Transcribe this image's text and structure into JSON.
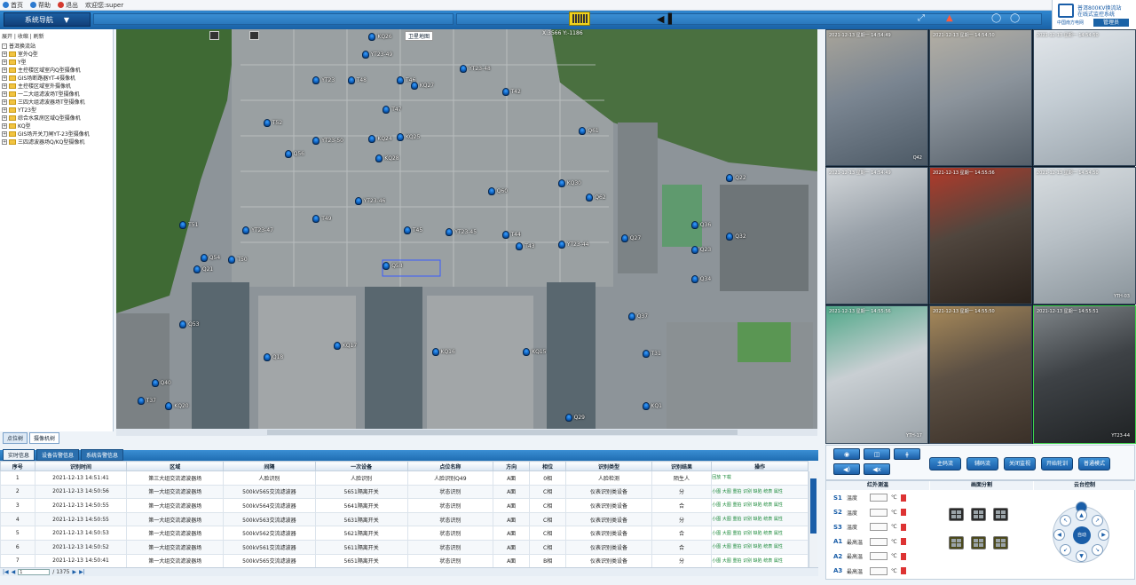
{
  "topbar": {
    "items": [
      {
        "label": "首页",
        "icon": "home-icon",
        "color": "#2d7bd0"
      },
      {
        "label": "帮助",
        "icon": "help-icon",
        "color": "#2d7bd0"
      },
      {
        "label": "退出",
        "icon": "exit-icon",
        "color": "#d43a2f"
      }
    ],
    "welcome": "欢迎您:super"
  },
  "header": {
    "nav_label": "系统导航",
    "logo_line1": "普洱800KV换流站",
    "logo_line2": "在线式监控系统",
    "logo_company": "中国南方电网",
    "user_btn": "管理员",
    "battery_icon": "battery-icon",
    "speaker_icon": "speaker-icon",
    "alarm_icon": "alarm-bell-icon"
  },
  "sidebar": {
    "ops": "展开 | 收缩 | 刷新",
    "root": "普洱换流站",
    "items": [
      "室外Q型",
      "Y型",
      "主控楼区域室内Q型摄像机",
      "GIS场断路器YT-4摄像机",
      "主控楼区域室外摄像机",
      "一二大组滤波场T型摄像机",
      "三四大组滤波器场T型摄像机",
      "YT23型",
      "综合水泵房区域Q型摄像机",
      "KQ型",
      "GIS场开关刀闸YT-23型摄像机",
      "三四滤波器场Q/KQ型摄像机"
    ],
    "tabs": [
      "点位树",
      "摄像机树"
    ]
  },
  "map": {
    "mode_label": "卫星地图",
    "coord": "X:3566 Y:-1186",
    "markers": [
      {
        "id": "KQ26",
        "x": 0.36,
        "y": 0.01
      },
      {
        "id": "YT23-49",
        "x": 0.35,
        "y": 0.055
      },
      {
        "id": "YT23-48",
        "x": 0.49,
        "y": 0.09
      },
      {
        "id": "YT23",
        "x": 0.28,
        "y": 0.12
      },
      {
        "id": "T48",
        "x": 0.33,
        "y": 0.12
      },
      {
        "id": "T46",
        "x": 0.4,
        "y": 0.12
      },
      {
        "id": "KQ27",
        "x": 0.42,
        "y": 0.135
      },
      {
        "id": "T42",
        "x": 0.55,
        "y": 0.15
      },
      {
        "id": "T47",
        "x": 0.38,
        "y": 0.195
      },
      {
        "id": "T52",
        "x": 0.21,
        "y": 0.23
      },
      {
        "id": "KQ24",
        "x": 0.36,
        "y": 0.27
      },
      {
        "id": "KQ25",
        "x": 0.4,
        "y": 0.265
      },
      {
        "id": "YT23-50",
        "x": 0.28,
        "y": 0.275
      },
      {
        "id": "Q56",
        "x": 0.24,
        "y": 0.31
      },
      {
        "id": "KQ28",
        "x": 0.37,
        "y": 0.32
      },
      {
        "id": "Q61",
        "x": 0.66,
        "y": 0.25
      },
      {
        "id": "KQ30",
        "x": 0.63,
        "y": 0.385
      },
      {
        "id": "Q60",
        "x": 0.53,
        "y": 0.405
      },
      {
        "id": "Q62",
        "x": 0.67,
        "y": 0.42
      },
      {
        "id": "YT23-46",
        "x": 0.34,
        "y": 0.43
      },
      {
        "id": "T49",
        "x": 0.28,
        "y": 0.475
      },
      {
        "id": "T51",
        "x": 0.09,
        "y": 0.49
      },
      {
        "id": "YT23-47",
        "x": 0.18,
        "y": 0.505
      },
      {
        "id": "T45",
        "x": 0.41,
        "y": 0.505
      },
      {
        "id": "YT23-45",
        "x": 0.47,
        "y": 0.51
      },
      {
        "id": "T44",
        "x": 0.55,
        "y": 0.515
      },
      {
        "id": "T43",
        "x": 0.57,
        "y": 0.545
      },
      {
        "id": "YT23-44",
        "x": 0.63,
        "y": 0.54
      },
      {
        "id": "Q27",
        "x": 0.72,
        "y": 0.525
      },
      {
        "id": "Q54",
        "x": 0.12,
        "y": 0.575
      },
      {
        "id": "T50",
        "x": 0.16,
        "y": 0.58
      },
      {
        "id": "Q21",
        "x": 0.11,
        "y": 0.605
      },
      {
        "id": "Q58",
        "x": 0.38,
        "y": 0.595
      },
      {
        "id": "Q36",
        "x": 0.82,
        "y": 0.49
      },
      {
        "id": "Q32",
        "x": 0.87,
        "y": 0.52
      },
      {
        "id": "Q23",
        "x": 0.82,
        "y": 0.555
      },
      {
        "id": "Q34",
        "x": 0.82,
        "y": 0.63
      },
      {
        "id": "Q22",
        "x": 0.87,
        "y": 0.37
      },
      {
        "id": "Q53",
        "x": 0.09,
        "y": 0.745
      },
      {
        "id": "Q37",
        "x": 0.73,
        "y": 0.725
      },
      {
        "id": "KQ17",
        "x": 0.31,
        "y": 0.8
      },
      {
        "id": "Q18",
        "x": 0.21,
        "y": 0.83
      },
      {
        "id": "KQ16",
        "x": 0.45,
        "y": 0.815
      },
      {
        "id": "KQ15",
        "x": 0.58,
        "y": 0.815
      },
      {
        "id": "T31",
        "x": 0.75,
        "y": 0.82
      },
      {
        "id": "Q40",
        "x": 0.05,
        "y": 0.895
      },
      {
        "id": "T37",
        "x": 0.03,
        "y": 0.94
      },
      {
        "id": "KQ20",
        "x": 0.07,
        "y": 0.955
      },
      {
        "id": "Q29",
        "x": 0.64,
        "y": 0.985
      },
      {
        "id": "KQ1",
        "x": 0.75,
        "y": 0.955
      }
    ]
  },
  "videos": [
    {
      "ts": "2021-12-13 星期一 14:54:49",
      "cam": "Q42",
      "bg": [
        "#7a8591",
        "#4d5a66",
        "#a8a49a"
      ]
    },
    {
      "ts": "2021-12-13 星期一 14:54:50",
      "cam": "",
      "bg": [
        "#8c949c",
        "#56606a",
        "#b3aea3"
      ]
    },
    {
      "ts": "2021-12-13 星期一 14:54:50",
      "cam": "",
      "bg": [
        "#c4cdd4",
        "#9aa4ac",
        "#e2e6ea"
      ]
    },
    {
      "ts": "2021-12-13 星期一 14:54:49",
      "cam": "",
      "bg": [
        "#9aa2aa",
        "#6d767e",
        "#d3d7da"
      ]
    },
    {
      "ts": "2021-12-13 星期一 14:55:56",
      "cam": "",
      "bg": [
        "#50463e",
        "#2a221c",
        "#b23a2a"
      ]
    },
    {
      "ts": "2021-12-13 星期一 14:54:50",
      "cam": "YTH-03",
      "bg": [
        "#b8c0c6",
        "#8a949b",
        "#d8dde0"
      ]
    },
    {
      "ts": "2021-12-13 星期一 14:55:56",
      "cam": "YTH-17",
      "bg": [
        "#c9cfd3",
        "#9ba3a9",
        "#4fa888"
      ]
    },
    {
      "ts": "2021-12-13 星期一 14:55:50",
      "cam": "",
      "bg": [
        "#5c5044",
        "#3a3028",
        "#a88a5a"
      ]
    },
    {
      "ts": "2021-12-13 星期一 14:55:51",
      "cam": "YT23-44",
      "bg": [
        "#3e4246",
        "#1f2224",
        "#80868a"
      ]
    },
    {
      "ts": "2021-12-13 星期一 14:55:50",
      "cam": "",
      "bg": [
        "#a6b0b8",
        "#7c868e",
        "#d0d6da"
      ]
    }
  ],
  "tabs": [
    "实时信息",
    "设备告警信息",
    "系统告警信息"
  ],
  "table": {
    "headers": [
      "序号",
      "识别时间",
      "区域",
      "间隔",
      "一次设备",
      "点位名称",
      "方向",
      "相位",
      "识别类型",
      "识别结果",
      "操作"
    ],
    "rows": [
      [
        "1",
        "2021-12-13 14:51:41",
        "第三大组交流滤波器场",
        "人脸识别",
        "人脸识别",
        "人脸识别Q49",
        "A面",
        "0相",
        "人脸检测",
        "陌生人",
        "回放 下载"
      ],
      [
        "2",
        "2021-12-13 14:50:56",
        "第一大组交流滤波器场",
        "500kV565交流滤波器",
        "5651隔离开关",
        "状态识别",
        "A面",
        "C相",
        "仪表识别类设备",
        "分",
        "小图 大图 重拍 识别 缺陷 统表 属性"
      ],
      [
        "3",
        "2021-12-13 14:50:55",
        "第一大组交流滤波器场",
        "500kV564交流滤波器",
        "5641隔离开关",
        "状态识别",
        "A面",
        "C相",
        "仪表识别类设备",
        "合",
        "小图 大图 重拍 识别 缺陷 统表 属性"
      ],
      [
        "4",
        "2021-12-13 14:50:55",
        "第一大组交流滤波器场",
        "500kV563交流滤波器",
        "5631隔离开关",
        "状态识别",
        "A面",
        "C相",
        "仪表识别类设备",
        "分",
        "小图 大图 重拍 识别 缺陷 统表 属性"
      ],
      [
        "5",
        "2021-12-13 14:50:53",
        "第一大组交流滤波器场",
        "500kV562交流滤波器",
        "5621隔离开关",
        "状态识别",
        "A面",
        "C相",
        "仪表识别类设备",
        "合",
        "小图 大图 重拍 识别 缺陷 统表 属性"
      ],
      [
        "6",
        "2021-12-13 14:50:52",
        "第一大组交流滤波器场",
        "500kV561交流滤波器",
        "5611隔离开关",
        "状态识别",
        "A面",
        "C相",
        "仪表识别类设备",
        "合",
        "小图 大图 重拍 识别 缺陷 统表 属性"
      ],
      [
        "7",
        "2021-12-13 14:50:41",
        "第一大组交流滤波器场",
        "500kV565交流滤波器",
        "5651隔离开关",
        "状态识别",
        "A面",
        "B相",
        "仪表识别类设备",
        "分",
        "小图 大图 重拍 识别 缺陷 统表 属性"
      ]
    ]
  },
  "pager": {
    "page": "1",
    "total": "/ 1375"
  },
  "controls": {
    "buttons": [
      "主码流",
      "辅码流",
      "关闭监视",
      "开始轮训",
      "普通模式"
    ],
    "sections": [
      "红外测温",
      "画面分割",
      "云台控制"
    ],
    "sensors": [
      {
        "k": "S1",
        "l": "温度",
        "u": "℃"
      },
      {
        "k": "S2",
        "l": "温度",
        "u": "℃"
      },
      {
        "k": "S3",
        "l": "温度",
        "u": "℃"
      },
      {
        "k": "A1",
        "l": "最高温",
        "u": "℃"
      },
      {
        "k": "A2",
        "l": "最高温",
        "u": "℃"
      },
      {
        "k": "A3",
        "l": "最高温",
        "u": "℃"
      }
    ],
    "ptz_center": "自动"
  }
}
